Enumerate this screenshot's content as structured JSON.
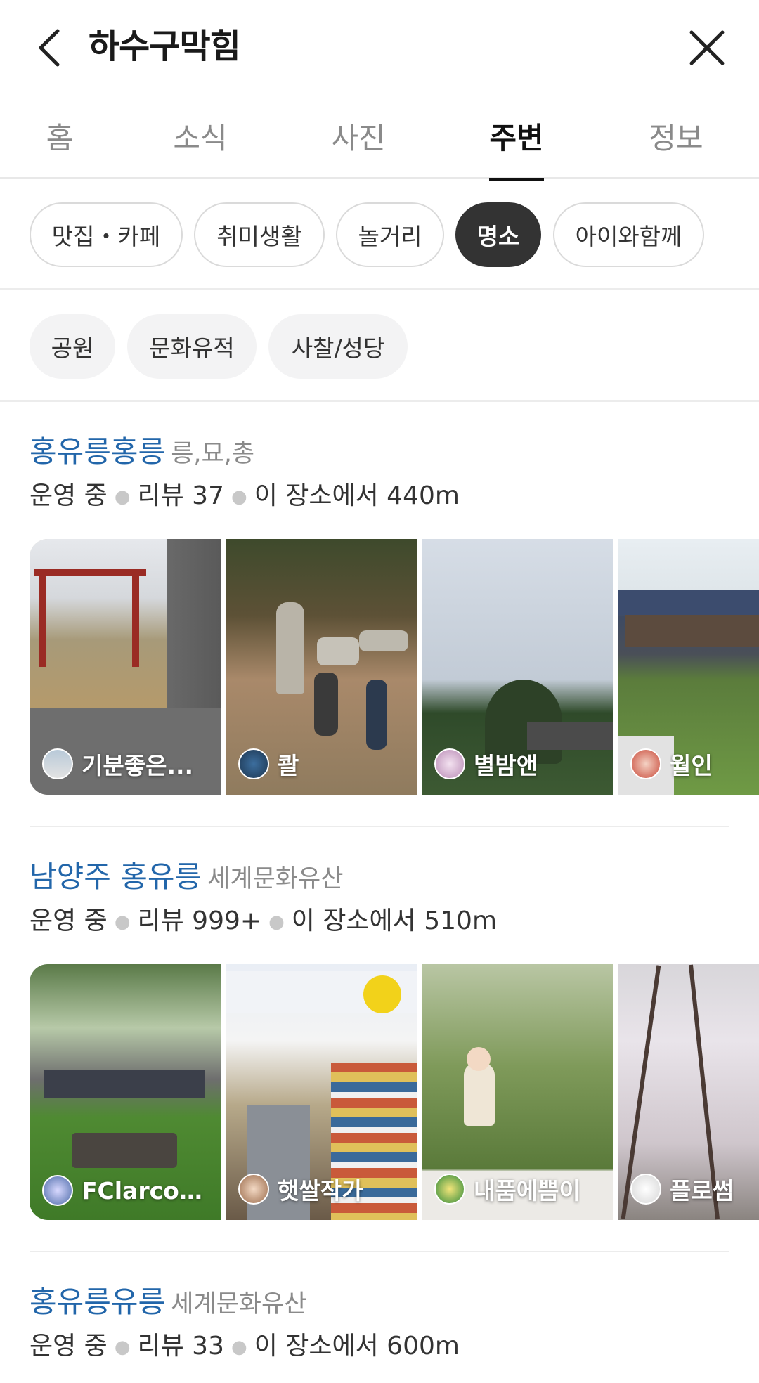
{
  "header": {
    "title": "하수구막힘"
  },
  "tabs": [
    {
      "label": "홈"
    },
    {
      "label": "소식"
    },
    {
      "label": "사진"
    },
    {
      "label": "주변"
    },
    {
      "label": "정보"
    }
  ],
  "categories": [
    {
      "label": "맛집・카페"
    },
    {
      "label": "취미생활"
    },
    {
      "label": "놀거리"
    },
    {
      "label": "명소"
    },
    {
      "label": "아이와함께"
    }
  ],
  "subcategories": [
    {
      "label": "공원"
    },
    {
      "label": "문화유적"
    },
    {
      "label": "사찰/성당"
    }
  ],
  "meta_labels": {
    "status": "운영 중"
  },
  "places": [
    {
      "name": "홍유릉홍릉",
      "category": "릉,묘,총",
      "reviews": "리뷰 37",
      "distance": "이 장소에서 440m",
      "photos": [
        {
          "user": "기분좋은..."
        },
        {
          "user": "콸"
        },
        {
          "user": "별밤앤"
        },
        {
          "user": "월인"
        }
      ]
    },
    {
      "name": "남양주 홍유릉",
      "category": "세계문화유산",
      "reviews": "리뷰 999+",
      "distance": "이 장소에서 510m",
      "photos": [
        {
          "user": "FClarcon..."
        },
        {
          "user": "햇쌀작가"
        },
        {
          "user": "내품에쁨이"
        },
        {
          "user": "플로썸"
        }
      ]
    },
    {
      "name": "홍유릉유릉",
      "category": "세계문화유산",
      "reviews": "리뷰 33",
      "distance": "이 장소에서 600m"
    }
  ],
  "colors": {
    "link_blue": "#2266aa",
    "selected_chip": "#333333",
    "muted_text": "#8a8a8a"
  }
}
